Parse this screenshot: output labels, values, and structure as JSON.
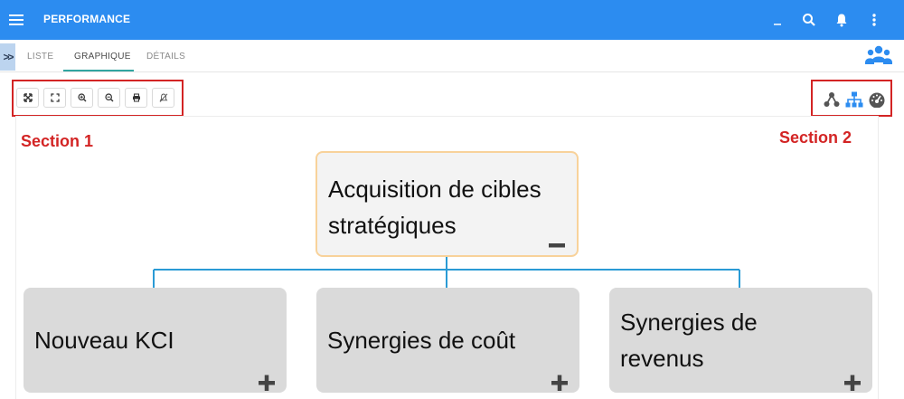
{
  "header": {
    "title": "PERFORMANCE",
    "bg_color": "#2c8cf0",
    "icons": [
      "menu-icon",
      "minimize-icon",
      "search-icon",
      "bell-icon",
      "more-vertical-icon"
    ]
  },
  "tabs": {
    "expander": ">>",
    "items": [
      {
        "label": "LISTE",
        "active": false
      },
      {
        "label": "GRAPHIQUE",
        "active": true
      },
      {
        "label": "DÉTAILS",
        "active": false
      }
    ],
    "active_color": "#31a5a0"
  },
  "toolbar": {
    "buttons": [
      "expand-icon",
      "fullscreen-icon",
      "zoom-in-icon",
      "zoom-out-icon",
      "print-icon",
      "no-notify-icon"
    ]
  },
  "view_switch": {
    "icons": [
      "network-icon",
      "hierarchy-icon",
      "dashboard-icon"
    ]
  },
  "annotations": {
    "section1": "Section 1",
    "section2": "Section 2",
    "color": "#d32424"
  },
  "chart": {
    "root": {
      "line1": "Acquisition de cibles",
      "line2": "stratégiques",
      "toggle": "collapse"
    },
    "children": [
      {
        "line1": "Nouveau KCI",
        "line2": "",
        "toggle": "expand"
      },
      {
        "line1": "Synergies de coût",
        "line2": "",
        "toggle": "expand"
      },
      {
        "line1": "Synergies de",
        "line2": "revenus",
        "toggle": "expand"
      }
    ],
    "connector_color": "#2a9bd5"
  }
}
